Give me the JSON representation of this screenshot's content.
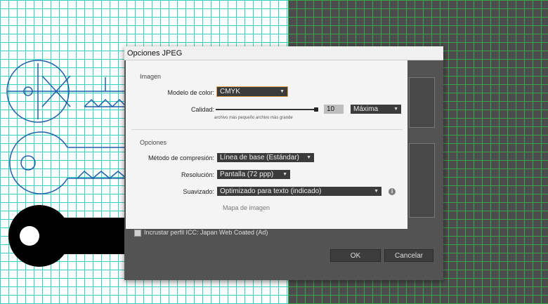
{
  "dialog": {
    "title": "Opciones JPEG",
    "image_section": {
      "heading": "Imagen",
      "color_model_label": "Modelo de color:",
      "color_model_value": "CMYK",
      "quality_label": "Calidad:",
      "quality_value": "10",
      "quality_preset": "Máxima",
      "quality_level": 10,
      "quality_hint": "archivo más pequeño  archivo más grande"
    },
    "options_section": {
      "heading": "Opciones",
      "compression_label": "Método de compresión:",
      "compression_value": "Línea de base (Estándar)",
      "resolution_label": "Resolución:",
      "resolution_value": "Pantalla (72 ppp)",
      "antialias_label": "Suavizado:",
      "antialias_value": "Optimizado para texto (indicado)",
      "image_map_label": "Mapa de imagen"
    },
    "icc_label": "Incrustar perfil ICC: Japan Web Coated (Ad)",
    "ok_label": "OK",
    "cancel_label": "Cancelar"
  },
  "colors": {
    "grid_light": "#2fd3c0",
    "grid_dark": "#39a84a",
    "artwork_stroke": "#1f5fa8",
    "dialog_bg": "#535353",
    "focus_outline": "#d89a4a"
  }
}
